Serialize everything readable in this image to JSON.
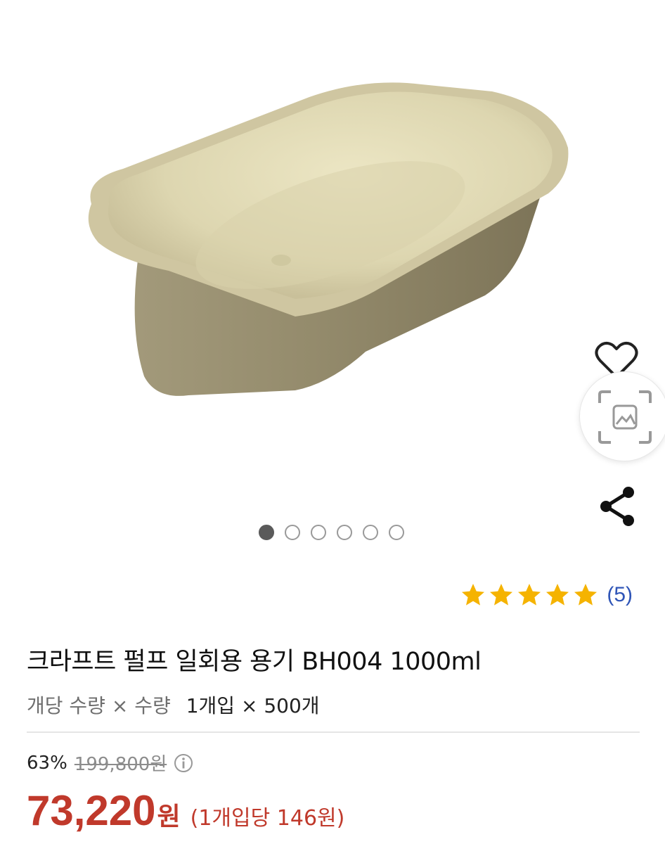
{
  "product": {
    "image_alt": "kraft pulp disposable container",
    "rating": {
      "stars": 5,
      "max_stars": 5,
      "review_count": "(5)"
    },
    "title": "크라프트 펄프 일회용 용기 BH004 1000ml",
    "quantity": {
      "label": "개당 수량 × 수량",
      "value": "1개입 × 500개"
    },
    "pricing": {
      "discount": "63%",
      "original_price": "199,800원",
      "price": "73,220",
      "currency": "원",
      "unit_price": "(1개입당 146원)"
    },
    "gallery": {
      "total": 6,
      "active_index": 0
    }
  },
  "actions": {
    "favorite_icon": "heart-icon",
    "lens_icon": "image-search-icon",
    "share_icon": "share-icon"
  },
  "colors": {
    "price": "#c0392b",
    "star": "#f5b301",
    "review_link": "#2f55b7",
    "product_inner": "#e2dcb5",
    "product_outer": "#948a6a"
  }
}
